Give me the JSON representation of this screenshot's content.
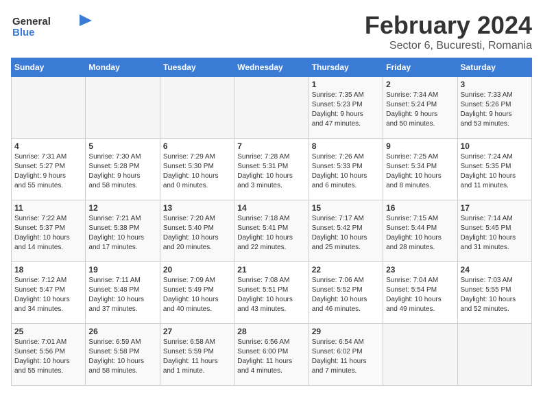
{
  "logo": {
    "general": "General",
    "blue": "Blue"
  },
  "title": "February 2024",
  "subtitle": "Sector 6, Bucuresti, Romania",
  "days_of_week": [
    "Sunday",
    "Monday",
    "Tuesday",
    "Wednesday",
    "Thursday",
    "Friday",
    "Saturday"
  ],
  "weeks": [
    [
      {
        "day": "",
        "content": ""
      },
      {
        "day": "",
        "content": ""
      },
      {
        "day": "",
        "content": ""
      },
      {
        "day": "",
        "content": ""
      },
      {
        "day": "1",
        "content": "Sunrise: 7:35 AM\nSunset: 5:23 PM\nDaylight: 9 hours\nand 47 minutes."
      },
      {
        "day": "2",
        "content": "Sunrise: 7:34 AM\nSunset: 5:24 PM\nDaylight: 9 hours\nand 50 minutes."
      },
      {
        "day": "3",
        "content": "Sunrise: 7:33 AM\nSunset: 5:26 PM\nDaylight: 9 hours\nand 53 minutes."
      }
    ],
    [
      {
        "day": "4",
        "content": "Sunrise: 7:31 AM\nSunset: 5:27 PM\nDaylight: 9 hours\nand 55 minutes."
      },
      {
        "day": "5",
        "content": "Sunrise: 7:30 AM\nSunset: 5:28 PM\nDaylight: 9 hours\nand 58 minutes."
      },
      {
        "day": "6",
        "content": "Sunrise: 7:29 AM\nSunset: 5:30 PM\nDaylight: 10 hours\nand 0 minutes."
      },
      {
        "day": "7",
        "content": "Sunrise: 7:28 AM\nSunset: 5:31 PM\nDaylight: 10 hours\nand 3 minutes."
      },
      {
        "day": "8",
        "content": "Sunrise: 7:26 AM\nSunset: 5:33 PM\nDaylight: 10 hours\nand 6 minutes."
      },
      {
        "day": "9",
        "content": "Sunrise: 7:25 AM\nSunset: 5:34 PM\nDaylight: 10 hours\nand 8 minutes."
      },
      {
        "day": "10",
        "content": "Sunrise: 7:24 AM\nSunset: 5:35 PM\nDaylight: 10 hours\nand 11 minutes."
      }
    ],
    [
      {
        "day": "11",
        "content": "Sunrise: 7:22 AM\nSunset: 5:37 PM\nDaylight: 10 hours\nand 14 minutes."
      },
      {
        "day": "12",
        "content": "Sunrise: 7:21 AM\nSunset: 5:38 PM\nDaylight: 10 hours\nand 17 minutes."
      },
      {
        "day": "13",
        "content": "Sunrise: 7:20 AM\nSunset: 5:40 PM\nDaylight: 10 hours\nand 20 minutes."
      },
      {
        "day": "14",
        "content": "Sunrise: 7:18 AM\nSunset: 5:41 PM\nDaylight: 10 hours\nand 22 minutes."
      },
      {
        "day": "15",
        "content": "Sunrise: 7:17 AM\nSunset: 5:42 PM\nDaylight: 10 hours\nand 25 minutes."
      },
      {
        "day": "16",
        "content": "Sunrise: 7:15 AM\nSunset: 5:44 PM\nDaylight: 10 hours\nand 28 minutes."
      },
      {
        "day": "17",
        "content": "Sunrise: 7:14 AM\nSunset: 5:45 PM\nDaylight: 10 hours\nand 31 minutes."
      }
    ],
    [
      {
        "day": "18",
        "content": "Sunrise: 7:12 AM\nSunset: 5:47 PM\nDaylight: 10 hours\nand 34 minutes."
      },
      {
        "day": "19",
        "content": "Sunrise: 7:11 AM\nSunset: 5:48 PM\nDaylight: 10 hours\nand 37 minutes."
      },
      {
        "day": "20",
        "content": "Sunrise: 7:09 AM\nSunset: 5:49 PM\nDaylight: 10 hours\nand 40 minutes."
      },
      {
        "day": "21",
        "content": "Sunrise: 7:08 AM\nSunset: 5:51 PM\nDaylight: 10 hours\nand 43 minutes."
      },
      {
        "day": "22",
        "content": "Sunrise: 7:06 AM\nSunset: 5:52 PM\nDaylight: 10 hours\nand 46 minutes."
      },
      {
        "day": "23",
        "content": "Sunrise: 7:04 AM\nSunset: 5:54 PM\nDaylight: 10 hours\nand 49 minutes."
      },
      {
        "day": "24",
        "content": "Sunrise: 7:03 AM\nSunset: 5:55 PM\nDaylight: 10 hours\nand 52 minutes."
      }
    ],
    [
      {
        "day": "25",
        "content": "Sunrise: 7:01 AM\nSunset: 5:56 PM\nDaylight: 10 hours\nand 55 minutes."
      },
      {
        "day": "26",
        "content": "Sunrise: 6:59 AM\nSunset: 5:58 PM\nDaylight: 10 hours\nand 58 minutes."
      },
      {
        "day": "27",
        "content": "Sunrise: 6:58 AM\nSunset: 5:59 PM\nDaylight: 11 hours\nand 1 minute."
      },
      {
        "day": "28",
        "content": "Sunrise: 6:56 AM\nSunset: 6:00 PM\nDaylight: 11 hours\nand 4 minutes."
      },
      {
        "day": "29",
        "content": "Sunrise: 6:54 AM\nSunset: 6:02 PM\nDaylight: 11 hours\nand 7 minutes."
      },
      {
        "day": "",
        "content": ""
      },
      {
        "day": "",
        "content": ""
      }
    ]
  ]
}
